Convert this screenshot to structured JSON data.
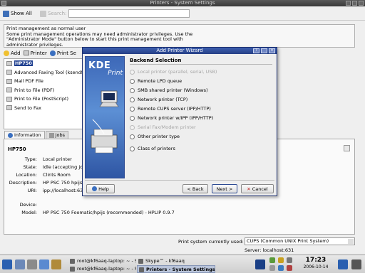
{
  "window": {
    "title": "Printers - System Settings"
  },
  "toolbar": {
    "show_all": "Show All",
    "search_placeholder": "Search:"
  },
  "info_text": [
    "Print management as normal user",
    "Some print management operations may need administrator privileges. Use the",
    "\"Administrator Mode\" button below to start this print management tool with",
    "administrator privileges."
  ],
  "pm_toolbar": {
    "add": "Add",
    "printer": "Printer",
    "print_settings": "Print Se"
  },
  "printers": [
    {
      "label": "HP750",
      "icon": "printer-icon"
    },
    {
      "label": "Advanced Faxing Tool (ksendf",
      "icon": "fax-icon"
    },
    {
      "label": "Mail PDF File",
      "icon": "mail-icon"
    },
    {
      "label": "Print to File (PDF)",
      "icon": "pdf-icon"
    },
    {
      "label": "Print to File (PostScript)",
      "icon": "ps-icon"
    },
    {
      "label": "Send to Fax",
      "icon": "fax-icon"
    }
  ],
  "tabs": {
    "information": "Information",
    "jobs": "Jobs"
  },
  "details": {
    "name": "HP750",
    "type_k": "Type:",
    "type_v": "Local printer",
    "state_k": "State:",
    "state_v": "Idle (accepting jobs)",
    "location_k": "Location:",
    "location_v": "Clints Room",
    "desc_k": "Description:",
    "desc_v": "HP PSC 750 hpijs",
    "uri_k": "URI:",
    "uri_v": "ipp://localhost:631",
    "device_k": "Device:",
    "device_v": "",
    "model_k": "Model:",
    "model_v": "HP PSC 750 Foomatic/hpijs (recommended) - HPLIP 0.9.7"
  },
  "print_system": {
    "label": "Print system currently used:",
    "value": "CUPS (Common UNIX Print System)",
    "server": "Server: localhost:631"
  },
  "dialog": {
    "title": "Add Printer Wizard",
    "logo_top": "KDE",
    "logo_bottom": "Print",
    "section": "Backend Selection",
    "options": [
      {
        "label": "Local printer (parallel, serial, USB)",
        "enabled": false
      },
      {
        "label": "Remote LPD queue",
        "enabled": true
      },
      {
        "label": "SMB shared printer (Windows)",
        "enabled": true
      },
      {
        "label": "Network printer (TCP)",
        "enabled": true
      },
      {
        "label": "Remote CUPS server (IPP/HTTP)",
        "enabled": true
      },
      {
        "label": "Network printer w/IPP (IPP/HTTP)",
        "enabled": true
      },
      {
        "label": "Serial Fax/Modem printer",
        "enabled": false
      },
      {
        "label": "Other printer type",
        "enabled": true
      },
      {
        "label": "Class of printers",
        "enabled": true
      }
    ],
    "help": "Help",
    "back": "< Back",
    "next": "Next >",
    "cancel": "Cancel"
  },
  "taskbar": {
    "tasks": [
      "root@kf6aaq-laptop: ~ - Sh",
      "root@kf6aaq-laptop: ~ - Sh",
      "Skype™ - kf6aaq",
      "Printers - System Settings"
    ],
    "time": "17:23",
    "date": "2006-10-14"
  },
  "colors": {
    "accent": "#263f86",
    "selection": "#1f3f8f"
  }
}
